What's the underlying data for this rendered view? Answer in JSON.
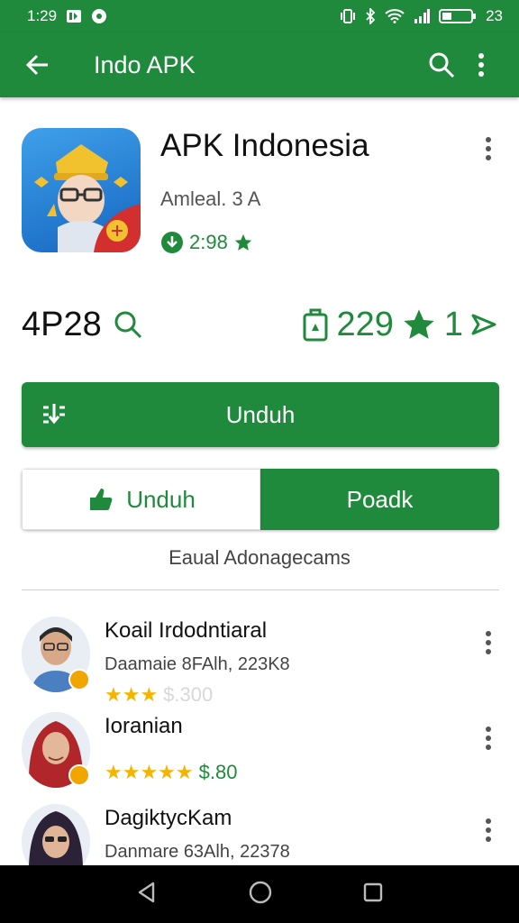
{
  "status_bar": {
    "time": "1:29",
    "battery": "23"
  },
  "app_bar": {
    "title": "Indo APK"
  },
  "app": {
    "name": "APK Indonesia",
    "developer": "Amleal. 3 A",
    "rating_text": "2:98"
  },
  "stats": {
    "left_value": "4P28",
    "right_value": "229",
    "right_suffix": "1"
  },
  "actions": {
    "primary_label": "Unduh",
    "segment_left_label": "Unduh",
    "segment_right_label": "Poadk"
  },
  "section": {
    "label": "Eaual Adonagecams"
  },
  "reviews": [
    {
      "name": "Koail Irdodntiaral",
      "meta": "Daamaie 8FAlh, 223K8",
      "stars": "★★★",
      "price": "$.300"
    },
    {
      "name": "Ioranian",
      "stars": "★★★★★",
      "price": "$.80"
    },
    {
      "name": "DagiktycKam",
      "meta": "Danmare 63Alh, 22378"
    }
  ],
  "colors": {
    "primary": "#1f8a3c",
    "star": "#f5b400"
  }
}
